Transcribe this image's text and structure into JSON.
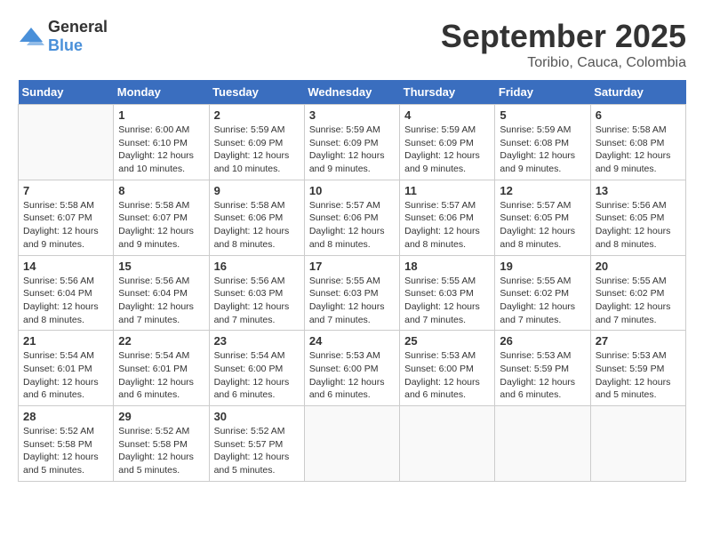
{
  "header": {
    "logo_general": "General",
    "logo_blue": "Blue",
    "month": "September 2025",
    "location": "Toribio, Cauca, Colombia"
  },
  "weekdays": [
    "Sunday",
    "Monday",
    "Tuesday",
    "Wednesday",
    "Thursday",
    "Friday",
    "Saturday"
  ],
  "weeks": [
    [
      {
        "day": "",
        "sunrise": "",
        "sunset": "",
        "daylight": ""
      },
      {
        "day": "1",
        "sunrise": "Sunrise: 6:00 AM",
        "sunset": "Sunset: 6:10 PM",
        "daylight": "Daylight: 12 hours and 10 minutes."
      },
      {
        "day": "2",
        "sunrise": "Sunrise: 5:59 AM",
        "sunset": "Sunset: 6:09 PM",
        "daylight": "Daylight: 12 hours and 10 minutes."
      },
      {
        "day": "3",
        "sunrise": "Sunrise: 5:59 AM",
        "sunset": "Sunset: 6:09 PM",
        "daylight": "Daylight: 12 hours and 9 minutes."
      },
      {
        "day": "4",
        "sunrise": "Sunrise: 5:59 AM",
        "sunset": "Sunset: 6:09 PM",
        "daylight": "Daylight: 12 hours and 9 minutes."
      },
      {
        "day": "5",
        "sunrise": "Sunrise: 5:59 AM",
        "sunset": "Sunset: 6:08 PM",
        "daylight": "Daylight: 12 hours and 9 minutes."
      },
      {
        "day": "6",
        "sunrise": "Sunrise: 5:58 AM",
        "sunset": "Sunset: 6:08 PM",
        "daylight": "Daylight: 12 hours and 9 minutes."
      }
    ],
    [
      {
        "day": "7",
        "sunrise": "Sunrise: 5:58 AM",
        "sunset": "Sunset: 6:07 PM",
        "daylight": "Daylight: 12 hours and 9 minutes."
      },
      {
        "day": "8",
        "sunrise": "Sunrise: 5:58 AM",
        "sunset": "Sunset: 6:07 PM",
        "daylight": "Daylight: 12 hours and 9 minutes."
      },
      {
        "day": "9",
        "sunrise": "Sunrise: 5:58 AM",
        "sunset": "Sunset: 6:06 PM",
        "daylight": "Daylight: 12 hours and 8 minutes."
      },
      {
        "day": "10",
        "sunrise": "Sunrise: 5:57 AM",
        "sunset": "Sunset: 6:06 PM",
        "daylight": "Daylight: 12 hours and 8 minutes."
      },
      {
        "day": "11",
        "sunrise": "Sunrise: 5:57 AM",
        "sunset": "Sunset: 6:06 PM",
        "daylight": "Daylight: 12 hours and 8 minutes."
      },
      {
        "day": "12",
        "sunrise": "Sunrise: 5:57 AM",
        "sunset": "Sunset: 6:05 PM",
        "daylight": "Daylight: 12 hours and 8 minutes."
      },
      {
        "day": "13",
        "sunrise": "Sunrise: 5:56 AM",
        "sunset": "Sunset: 6:05 PM",
        "daylight": "Daylight: 12 hours and 8 minutes."
      }
    ],
    [
      {
        "day": "14",
        "sunrise": "Sunrise: 5:56 AM",
        "sunset": "Sunset: 6:04 PM",
        "daylight": "Daylight: 12 hours and 8 minutes."
      },
      {
        "day": "15",
        "sunrise": "Sunrise: 5:56 AM",
        "sunset": "Sunset: 6:04 PM",
        "daylight": "Daylight: 12 hours and 7 minutes."
      },
      {
        "day": "16",
        "sunrise": "Sunrise: 5:56 AM",
        "sunset": "Sunset: 6:03 PM",
        "daylight": "Daylight: 12 hours and 7 minutes."
      },
      {
        "day": "17",
        "sunrise": "Sunrise: 5:55 AM",
        "sunset": "Sunset: 6:03 PM",
        "daylight": "Daylight: 12 hours and 7 minutes."
      },
      {
        "day": "18",
        "sunrise": "Sunrise: 5:55 AM",
        "sunset": "Sunset: 6:03 PM",
        "daylight": "Daylight: 12 hours and 7 minutes."
      },
      {
        "day": "19",
        "sunrise": "Sunrise: 5:55 AM",
        "sunset": "Sunset: 6:02 PM",
        "daylight": "Daylight: 12 hours and 7 minutes."
      },
      {
        "day": "20",
        "sunrise": "Sunrise: 5:55 AM",
        "sunset": "Sunset: 6:02 PM",
        "daylight": "Daylight: 12 hours and 7 minutes."
      }
    ],
    [
      {
        "day": "21",
        "sunrise": "Sunrise: 5:54 AM",
        "sunset": "Sunset: 6:01 PM",
        "daylight": "Daylight: 12 hours and 6 minutes."
      },
      {
        "day": "22",
        "sunrise": "Sunrise: 5:54 AM",
        "sunset": "Sunset: 6:01 PM",
        "daylight": "Daylight: 12 hours and 6 minutes."
      },
      {
        "day": "23",
        "sunrise": "Sunrise: 5:54 AM",
        "sunset": "Sunset: 6:00 PM",
        "daylight": "Daylight: 12 hours and 6 minutes."
      },
      {
        "day": "24",
        "sunrise": "Sunrise: 5:53 AM",
        "sunset": "Sunset: 6:00 PM",
        "daylight": "Daylight: 12 hours and 6 minutes."
      },
      {
        "day": "25",
        "sunrise": "Sunrise: 5:53 AM",
        "sunset": "Sunset: 6:00 PM",
        "daylight": "Daylight: 12 hours and 6 minutes."
      },
      {
        "day": "26",
        "sunrise": "Sunrise: 5:53 AM",
        "sunset": "Sunset: 5:59 PM",
        "daylight": "Daylight: 12 hours and 6 minutes."
      },
      {
        "day": "27",
        "sunrise": "Sunrise: 5:53 AM",
        "sunset": "Sunset: 5:59 PM",
        "daylight": "Daylight: 12 hours and 5 minutes."
      }
    ],
    [
      {
        "day": "28",
        "sunrise": "Sunrise: 5:52 AM",
        "sunset": "Sunset: 5:58 PM",
        "daylight": "Daylight: 12 hours and 5 minutes."
      },
      {
        "day": "29",
        "sunrise": "Sunrise: 5:52 AM",
        "sunset": "Sunset: 5:58 PM",
        "daylight": "Daylight: 12 hours and 5 minutes."
      },
      {
        "day": "30",
        "sunrise": "Sunrise: 5:52 AM",
        "sunset": "Sunset: 5:57 PM",
        "daylight": "Daylight: 12 hours and 5 minutes."
      },
      {
        "day": "",
        "sunrise": "",
        "sunset": "",
        "daylight": ""
      },
      {
        "day": "",
        "sunrise": "",
        "sunset": "",
        "daylight": ""
      },
      {
        "day": "",
        "sunrise": "",
        "sunset": "",
        "daylight": ""
      },
      {
        "day": "",
        "sunrise": "",
        "sunset": "",
        "daylight": ""
      }
    ]
  ]
}
